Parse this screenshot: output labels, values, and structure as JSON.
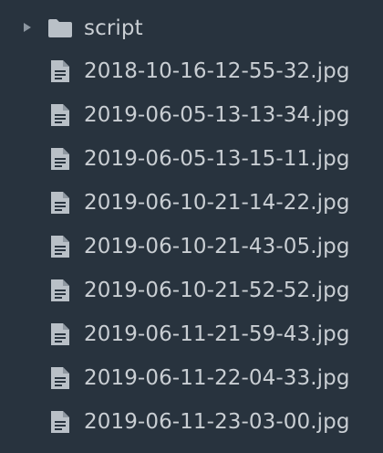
{
  "file_tree": {
    "folder": {
      "name": "script",
      "icon": "folder-icon",
      "expanded": false
    },
    "files": [
      {
        "name": "2018-10-16-12-55-32.jpg",
        "icon": "file-icon"
      },
      {
        "name": "2019-06-05-13-13-34.jpg",
        "icon": "file-icon"
      },
      {
        "name": "2019-06-05-13-15-11.jpg",
        "icon": "file-icon"
      },
      {
        "name": "2019-06-10-21-14-22.jpg",
        "icon": "file-icon"
      },
      {
        "name": "2019-06-10-21-43-05.jpg",
        "icon": "file-icon"
      },
      {
        "name": "2019-06-10-21-52-52.jpg",
        "icon": "file-icon"
      },
      {
        "name": "2019-06-11-21-59-43.jpg",
        "icon": "file-icon"
      },
      {
        "name": "2019-06-11-22-04-33.jpg",
        "icon": "file-icon"
      },
      {
        "name": "2019-06-11-23-03-00.jpg",
        "icon": "file-icon"
      }
    ]
  },
  "colors": {
    "background": "#28333e",
    "text": "#c9ced3",
    "icon": "#b9c0c7",
    "arrow": "#8c96a0"
  }
}
